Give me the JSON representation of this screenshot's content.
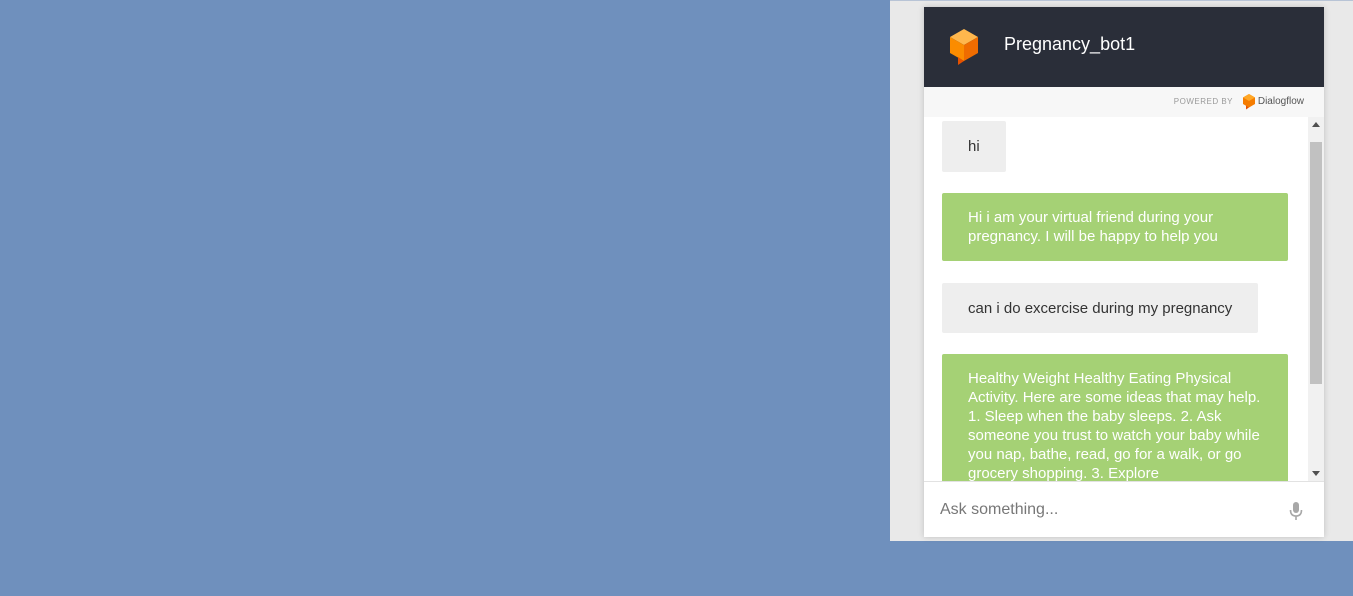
{
  "agent": {
    "name": "Pregnancy_bot1",
    "logo_icon": "dialogflow-cube-icon"
  },
  "powered_by": {
    "label": "POWERED BY",
    "brand": "Dialogflow",
    "brand_icon": "dialogflow-logo-icon"
  },
  "messages": [
    {
      "from": "user",
      "text": "hi"
    },
    {
      "from": "bot",
      "text": "Hi i am your virtual friend during your pregnancy. I will be happy to help you"
    },
    {
      "from": "user",
      "text": "can i do excercise during my pregnancy"
    },
    {
      "from": "bot",
      "text": "Healthy Weight Healthy Eating Physical Activity. Here are some ideas that may help. 1. Sleep when the baby sleeps. 2. Ask someone you trust to watch your baby while you nap, bathe, read, go for a walk, or go grocery shopping. 3. Explore"
    }
  ],
  "input": {
    "placeholder": "Ask something...",
    "value": "",
    "mic_icon": "microphone-icon"
  },
  "colors": {
    "page_background": "#6f90bd",
    "header_background": "#2a2e39",
    "bot_bubble": "#a5d175",
    "user_bubble": "#eeeeee",
    "logo_orange": "#f57c00"
  }
}
